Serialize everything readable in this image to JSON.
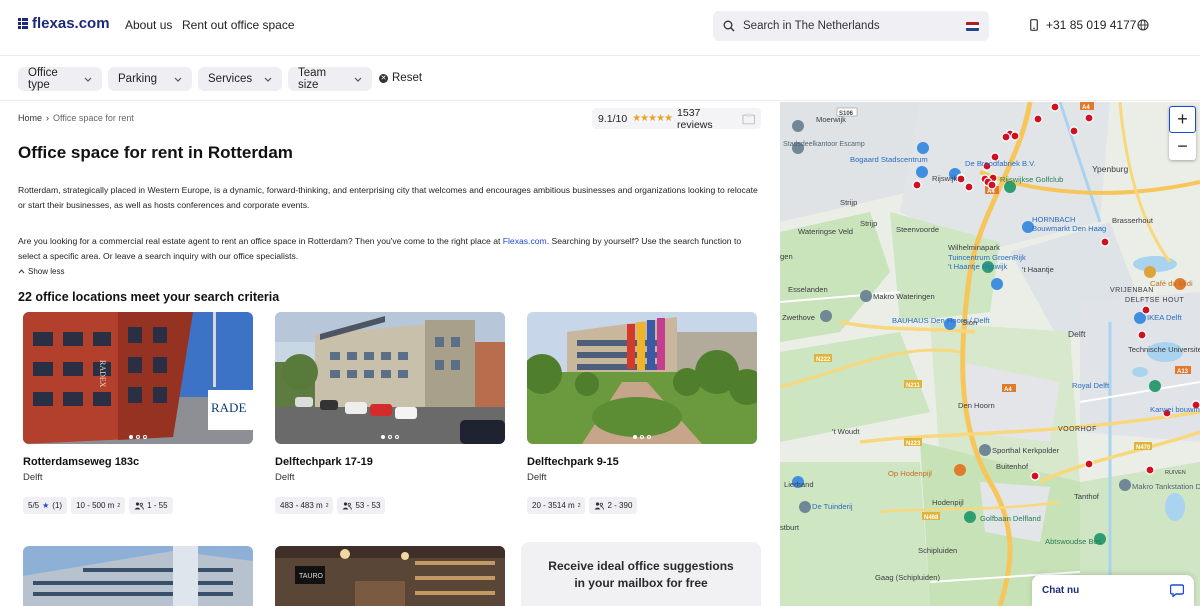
{
  "header": {
    "logo_text": "flexas.com",
    "nav": [
      "About us",
      "Rent out office space"
    ],
    "search_placeholder": "Search in The Netherlands",
    "phone": "+31 85 019 4177"
  },
  "filters": {
    "items": [
      "Office type",
      "Parking",
      "Services",
      "Team size"
    ],
    "reset_label": "Reset"
  },
  "breadcrumb": {
    "home": "Home",
    "separator": "›",
    "current": "Office space for rent"
  },
  "rating": {
    "score": "9.1/10",
    "stars": "★★★★★",
    "reviews": "1537 reviews"
  },
  "page_title": "Office space for rent in Rotterdam",
  "intro": {
    "p1": "Rotterdam, strategically placed in Western Europe, is a dynamic, forward-thinking, and enterprising city that welcomes and encourages ambitious businesses and organizations looking to relocate or start their businesses, as well as hosts conferences and corporate events.",
    "p2_before": "Are you looking for a commercial real estate agent to rent an office space in Rotterdam? Then you've come to the right place at ",
    "p2_link": "Flexas.com",
    "p2_after": ". Searching by yourself? Use the search function to select a specific area. Or leave a search inquiry with our office specialists.",
    "show_less": "Show less"
  },
  "results_title": "22 office locations meet your search criteria",
  "cards": [
    {
      "name": "Rotterdamseweg 183c",
      "city": "Delft",
      "rating": "5/5",
      "rating_count": "(1)",
      "size": "10 - 500 m",
      "people": "1 - 55"
    },
    {
      "name": "Delftechpark 17-19",
      "city": "Delft",
      "size": "483 - 483 m",
      "people": "53 - 53"
    },
    {
      "name": "Delftechpark 9-15",
      "city": "Delft",
      "size": "20 - 3514 m",
      "people": "2 - 390"
    }
  ],
  "image_signs": {
    "card1_sign1": "RADEX",
    "card1_sign2": "RADE",
    "card5_sign": "TAURO"
  },
  "promo": {
    "line1": "Receive ideal office suggestions",
    "line2": "in your mailbox for free"
  },
  "map": {
    "labels": [
      "Moerwijk",
      "Stadsdeelkantoor Escamp",
      "Bogaard Stadscentrum",
      "De Broodfabriek B.V.",
      "Rijswijk",
      "Rijswijkse Golfclub",
      "Ypenburg",
      "Strijp",
      "Wateringse Veld",
      "Steenvoorde",
      "HORNBACH",
      "Bouwmarkt Den Haag",
      "Brasserhout",
      "Wilhelminapark",
      "Tuincentrum GroenRijk",
      "'t Haantje Rijswijk",
      "'t Haantje",
      "Esselanden",
      "Makro Wateringen",
      "VRIJENBAN",
      "Café du Midi",
      "Zwethove",
      "BAUHAUS Den Hoorn / Delft",
      "Sion",
      "DELFTSE HOUT",
      "Delft",
      "IKEA Delft",
      "Technische Universiteit Delft",
      "Royal Delft",
      "Den Hoorn",
      "Karwei bouwmarkt",
      "'t Woudt",
      "VOORHOF",
      "Sporthal Kerkpolder",
      "Buitenhof",
      "Op Hodenpijl",
      "Lierhand",
      "Tanthof",
      "RUIVEN",
      "Makro Tankstation De",
      "De Tuinderij",
      "Hodenpijl",
      "Golfbaan Delfland",
      "Abtswoudse Bos",
      "Schipluiden",
      "Gaag (Schipluiden)",
      "gen",
      "stburt"
    ],
    "roads": [
      "A4",
      "A13",
      "N211",
      "N222",
      "N223",
      "N468",
      "N470",
      "S106"
    ]
  },
  "chat_label": "Chat nu",
  "colors": {
    "brand": "#1c2a7a",
    "link": "#1c4ad6",
    "star": "#e8a42a",
    "pin": "#d01020"
  }
}
